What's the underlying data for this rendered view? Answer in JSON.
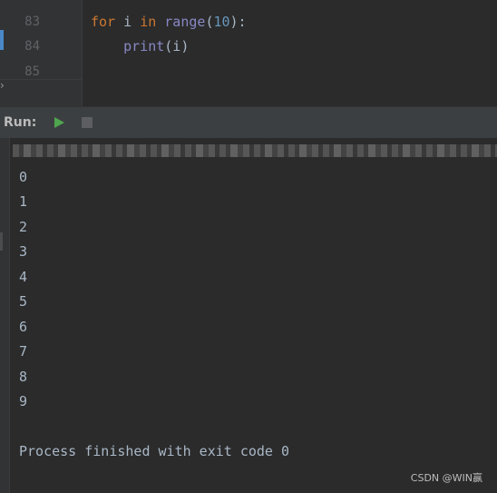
{
  "editor": {
    "line_numbers": [
      "83",
      "84",
      "85"
    ],
    "code": {
      "line1": {
        "kw_for": "for",
        "var": " i ",
        "kw_in": "in",
        "space": " ",
        "func": "range",
        "open": "(",
        "num": "10",
        "close": "):"
      },
      "line2": {
        "indent": "    ",
        "func": "print",
        "args": "(i)"
      }
    }
  },
  "run_panel": {
    "label": "Run:",
    "play_icon": "play-icon",
    "stop_icon": "stop-icon",
    "play_color": "#4fa64f"
  },
  "console": {
    "output": [
      "0",
      "1",
      "2",
      "3",
      "4",
      "5",
      "6",
      "7",
      "8",
      "9"
    ],
    "exit_message": "Process finished with exit code 0"
  },
  "watermark": "CSDN @WIN赢",
  "colors": {
    "keyword": "#cc7832",
    "builtin": "#8888c6",
    "number": "#6897bb",
    "text": "#a9b7c6",
    "background": "#2b2b2b"
  }
}
